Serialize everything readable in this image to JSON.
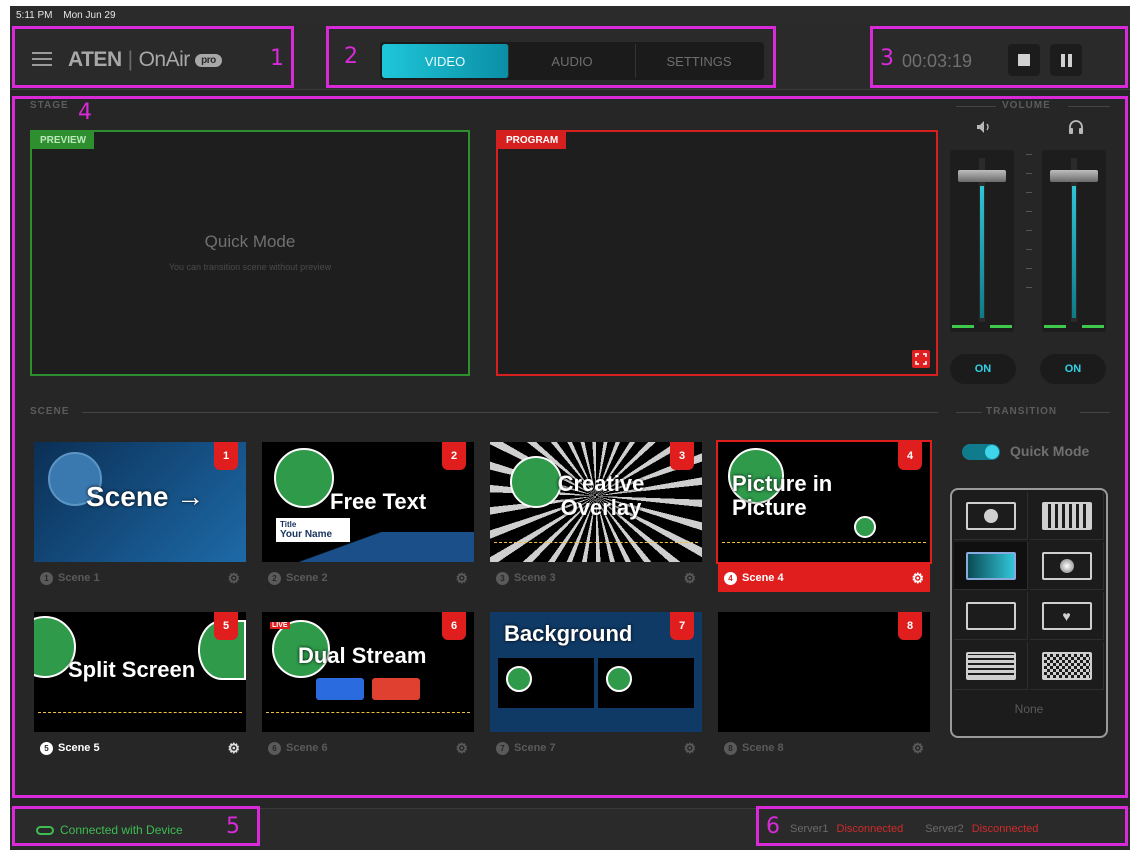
{
  "statusbar": {
    "time": "5:11 PM",
    "date": "Mon Jun 29"
  },
  "brand": {
    "aten": "ATEN",
    "sep": "|",
    "onair": "OnAir",
    "pro": "pro"
  },
  "annotations": [
    "1",
    "2",
    "3",
    "4",
    "5",
    "6"
  ],
  "tabs": [
    {
      "label": "VIDEO",
      "active": true
    },
    {
      "label": "AUDIO",
      "active": false
    },
    {
      "label": "SETTINGS",
      "active": false
    }
  ],
  "timer": "00:03:19",
  "stage": {
    "label": "STAGE",
    "preview_tag": "PREVIEW",
    "program_tag": "PROGRAM",
    "quick_mode_title": "Quick Mode",
    "quick_mode_sub": "You can transition scene without preview"
  },
  "volume": {
    "label": "VOLUME",
    "left_on": "ON",
    "right_on": "ON"
  },
  "scene_section": {
    "label": "SCENE"
  },
  "transition": {
    "label": "TRANSITION",
    "quick_mode": "Quick Mode",
    "none": "None"
  },
  "scenes": [
    {
      "badge": "1",
      "name": "Scene 1",
      "dot": "1",
      "title": "Scene →"
    },
    {
      "badge": "2",
      "name": "Scene 2",
      "dot": "2",
      "title": "Free Text",
      "lower_title": "Title",
      "lower_name": "Your Name"
    },
    {
      "badge": "3",
      "name": "Scene 3",
      "dot": "3",
      "title": "Creative Overlay"
    },
    {
      "badge": "4",
      "name": "Scene 4",
      "dot": "4",
      "title": "Picture in Picture"
    },
    {
      "badge": "5",
      "name": "Scene 5",
      "dot": "5",
      "title": "Split Screen"
    },
    {
      "badge": "6",
      "name": "Scene 6",
      "dot": "6",
      "title": "Dual Stream",
      "live": "LIVE"
    },
    {
      "badge": "7",
      "name": "Scene 7",
      "dot": "7",
      "title": "Background"
    },
    {
      "badge": "8",
      "name": "Scene 8",
      "dot": "8",
      "title": ""
    }
  ],
  "footer": {
    "connection": "Connected with Device",
    "server1_label": "Server1",
    "server1_status": "Disconnected",
    "server2_label": "Server2",
    "server2_status": "Disconnected"
  },
  "colors": {
    "accent": "#1fc6d9",
    "program": "#d61f1f",
    "preview": "#2d8f2d",
    "annotation": "#d82ad8"
  }
}
